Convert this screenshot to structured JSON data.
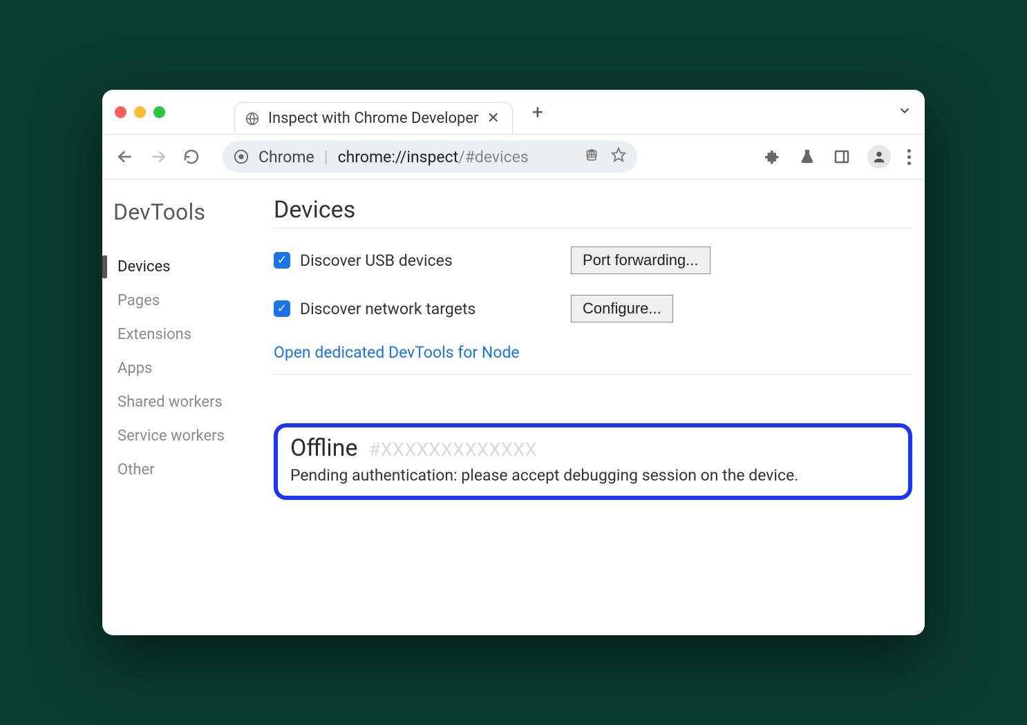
{
  "tab": {
    "title": "Inspect with Chrome Developer"
  },
  "omnibox": {
    "label": "Chrome",
    "url_bold": "chrome://inspect",
    "url_light": "/#devices"
  },
  "sidebar": {
    "title": "DevTools",
    "items": [
      {
        "label": "Devices",
        "active": true
      },
      {
        "label": "Pages"
      },
      {
        "label": "Extensions"
      },
      {
        "label": "Apps"
      },
      {
        "label": "Shared workers"
      },
      {
        "label": "Service workers"
      },
      {
        "label": "Other"
      }
    ]
  },
  "main": {
    "title": "Devices",
    "discover_usb_label": "Discover USB devices",
    "discover_usb_checked": true,
    "port_forwarding_label": "Port forwarding...",
    "discover_network_label": "Discover network targets",
    "discover_network_checked": true,
    "configure_label": "Configure...",
    "node_link": "Open dedicated DevTools for Node",
    "device": {
      "status": "Offline",
      "id": "#XXXXXXXXXXXXX",
      "message": "Pending authentication: please accept debugging session on the device."
    }
  }
}
